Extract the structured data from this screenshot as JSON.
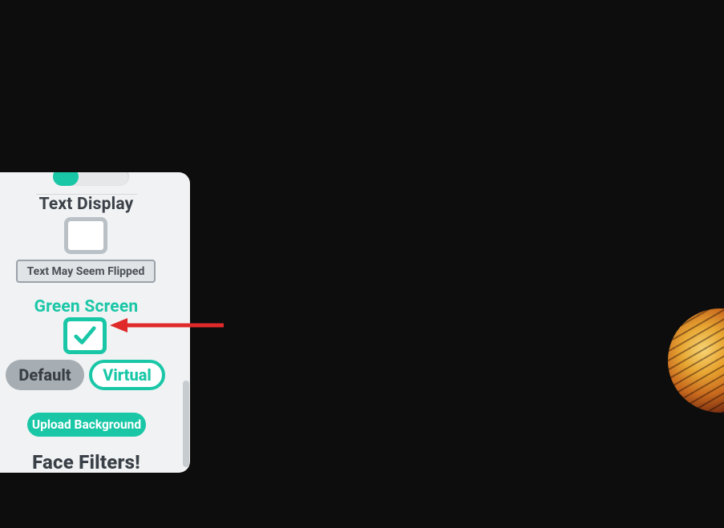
{
  "panel": {
    "text_display_label": "Text Display",
    "flipped_hint": "Text May Seem Flipped",
    "green_screen_label": "Green Screen",
    "bg_default_label": "Default",
    "bg_virtual_label": "Virtual",
    "upload_label": "Upload Background",
    "face_filters_label": "Face Filters!",
    "text_display_checked": false,
    "green_screen_checked": true,
    "bg_mode_selected": "Virtual"
  },
  "colors": {
    "accent": "#19c7a7",
    "arrow": "#e02a2a"
  }
}
